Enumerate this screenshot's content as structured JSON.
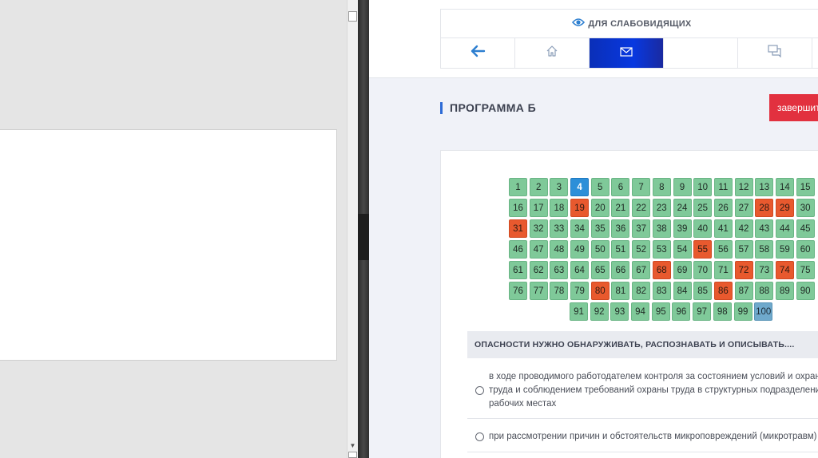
{
  "accessibility": {
    "label": "ДЛЯ СЛАБОВИДЯЩИХ",
    "icon": "eye-icon"
  },
  "nav": [
    {
      "name": "back",
      "icon": "arrow-left-icon"
    },
    {
      "name": "home",
      "icon": "home-icon"
    },
    {
      "name": "messages",
      "icon": "envelope-icon",
      "active": true
    },
    {
      "name": "blank",
      "icon": ""
    },
    {
      "name": "chat",
      "icon": "chat-icon"
    }
  ],
  "page": {
    "title": "ПРОГРАММА Б",
    "finish_label": "завершить"
  },
  "colors": {
    "correct": "#7fc999",
    "wrong": "#e8592e",
    "current": "#2d8fd8",
    "unanswered": "#6fa9cc",
    "finish": "#e2313f",
    "active_tab": "#0838e0"
  },
  "question_grid": {
    "current": 4,
    "wrong": [
      19,
      28,
      29,
      31,
      55,
      68,
      72,
      74,
      80,
      86
    ],
    "unanswered": [
      100
    ],
    "rows": [
      [
        1,
        2,
        3,
        4,
        5,
        6,
        7,
        8,
        9,
        10,
        11,
        12,
        13,
        14,
        15
      ],
      [
        16,
        17,
        18,
        19,
        20,
        21,
        22,
        23,
        24,
        25,
        26,
        27,
        28,
        29,
        30
      ],
      [
        31,
        32,
        33,
        34,
        35,
        36,
        37,
        38,
        39,
        40,
        41,
        42,
        43,
        44,
        45
      ],
      [
        46,
        47,
        48,
        49,
        50,
        51,
        52,
        53,
        54,
        55,
        56,
        57,
        58,
        59,
        60
      ],
      [
        61,
        62,
        63,
        64,
        65,
        66,
        67,
        68,
        69,
        70,
        71,
        72,
        73,
        74,
        75
      ],
      [
        76,
        77,
        78,
        79,
        80,
        81,
        82,
        83,
        84,
        85,
        86,
        87,
        88,
        89,
        90
      ],
      [
        91,
        92,
        93,
        94,
        95,
        96,
        97,
        98,
        99,
        100
      ]
    ]
  },
  "question": {
    "text": "ОПАСНОСТИ НУЖНО ОБНАРУЖИВАТЬ, РАСПОЗНАВАТЬ И ОПИСЫВАТЬ....",
    "answers": [
      {
        "lines": [
          "в ходе проводимого работодателем контроля за состоянием условий и охраны",
          "труда и соблюдением требований охраны труда в структурных подразделениях и на",
          "рабочих местах"
        ]
      },
      {
        "lines": [
          "при рассмотрении причин и обстоятельств микроповреждений (микротравм)"
        ]
      }
    ]
  }
}
